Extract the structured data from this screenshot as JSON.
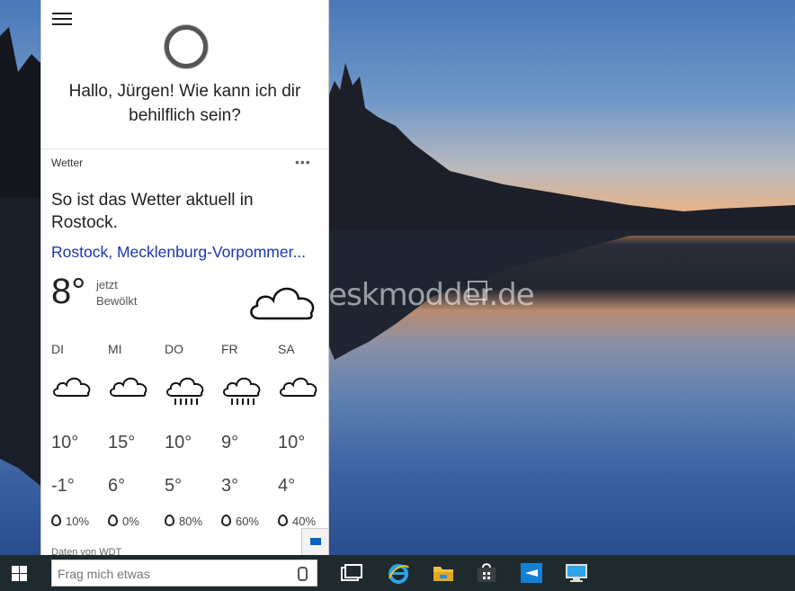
{
  "cortana": {
    "greeting": "Hallo, Jürgen! Wie kann ich dir behilflich sein?"
  },
  "weather": {
    "card_title": "Wetter",
    "more": "•••",
    "headline": "So ist das Wetter aktuell in Rostock.",
    "location": "Rostock, Mecklenburg-Vorpommer...",
    "current_temp": "8°",
    "current_time": "jetzt",
    "current_condition": "Bewölkt",
    "current_icon": "cloud-icon",
    "forecast": [
      {
        "day": "DI",
        "icon": "cloud-icon",
        "high": "10°",
        "low": "-1°",
        "rain": "10%"
      },
      {
        "day": "MI",
        "icon": "cloud-icon",
        "high": "15°",
        "low": "6°",
        "rain": "0%"
      },
      {
        "day": "DO",
        "icon": "rain-cloud-icon",
        "high": "10°",
        "low": "5°",
        "rain": "80%"
      },
      {
        "day": "FR",
        "icon": "rain-cloud-icon",
        "high": "9°",
        "low": "3°",
        "rain": "60%"
      },
      {
        "day": "SA",
        "icon": "cloud-icon",
        "high": "10°",
        "low": "4°",
        "rain": "40%"
      }
    ],
    "source": "Daten von WDT"
  },
  "watermark": "Deskmodder.de",
  "taskbar": {
    "search_placeholder": "Frag mich etwas",
    "icons": [
      "task-view-icon",
      "internet-explorer-icon",
      "file-explorer-icon",
      "store-icon",
      "app-icon",
      "remote-desktop-icon"
    ]
  },
  "colors": {
    "link": "#1a37b0",
    "taskbar": "#1f2a2e"
  }
}
